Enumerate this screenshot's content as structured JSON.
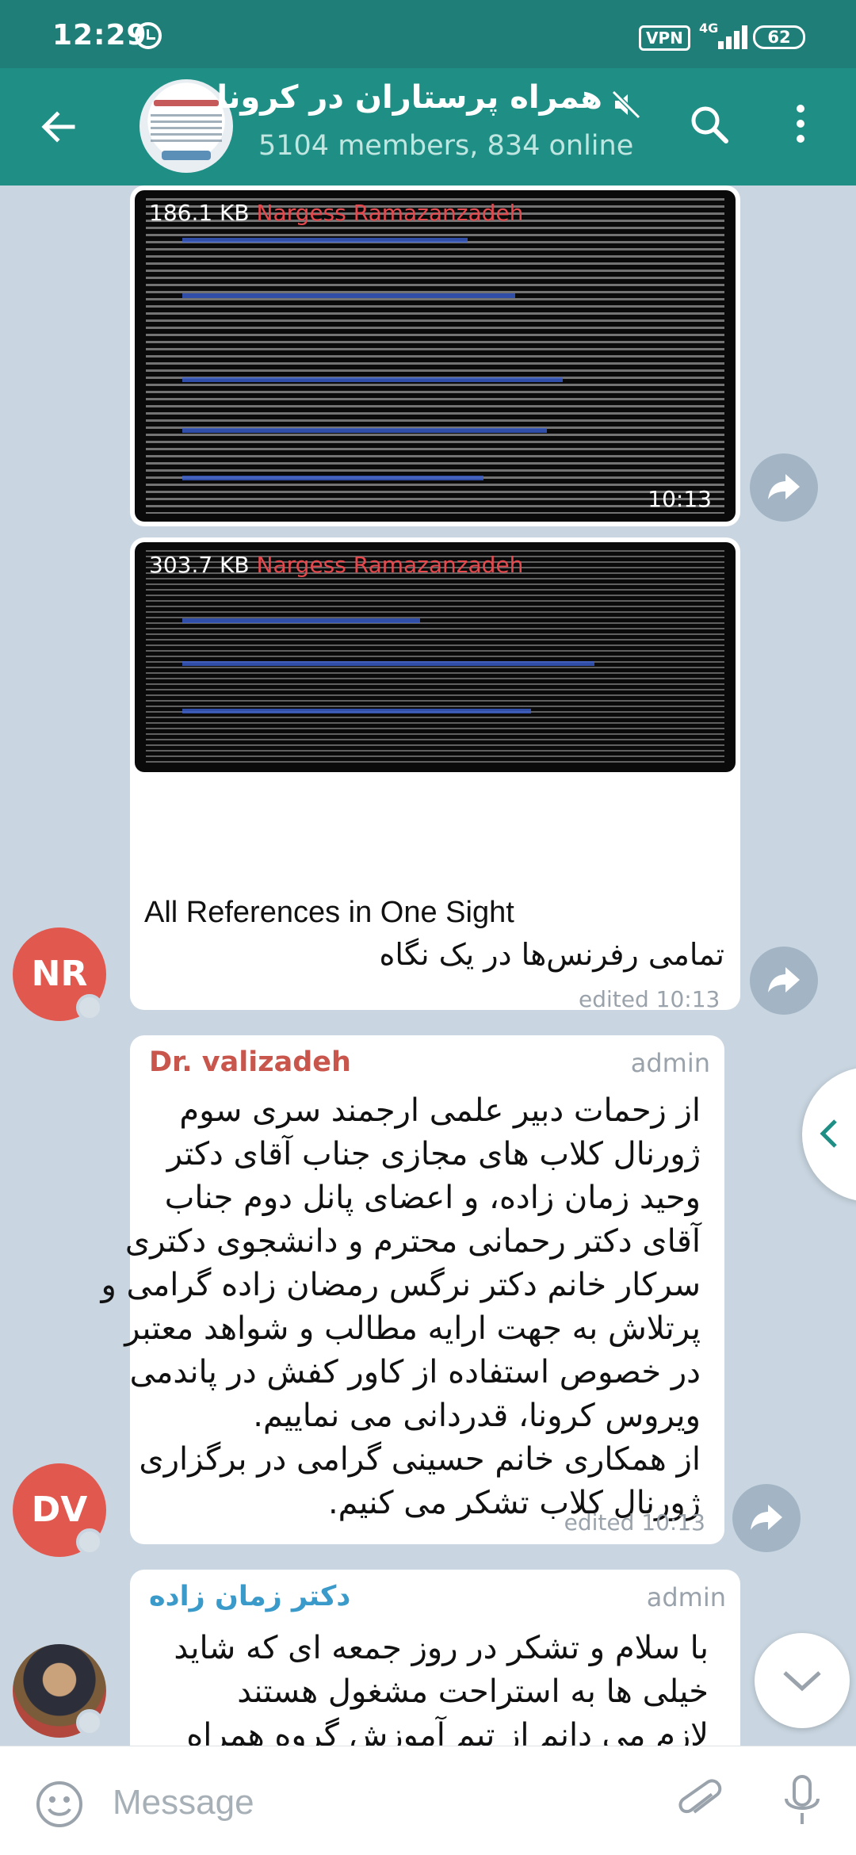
{
  "status_bar": {
    "time": "12:29",
    "vpn": "VPN",
    "network": "4G",
    "battery": "62"
  },
  "header": {
    "title": "همراه پرستاران در کرونا",
    "subtitle": "5104 members, 834 online"
  },
  "messages": [
    {
      "type": "file_image",
      "size": "186.1 KB",
      "sender": "Nargess Ramazanzadeh",
      "time": "10:13"
    },
    {
      "type": "file_image",
      "size": "303.7 KB",
      "sender": "Nargess Ramazanzadeh",
      "caption_en": "All References in One Sight",
      "caption_fa": "تمامی رفرنس‌ها در یک نگاه",
      "edited": "edited 10:13",
      "avatar_initials": "NR",
      "avatar_color": "#e1584f"
    },
    {
      "type": "text",
      "sender": "Dr. valizadeh",
      "sender_color": "#c9564d",
      "role": "admin",
      "lines": [
        "از زحمات دبیر علمی ارجمند سری سوم",
        "ژورنال کلاب های مجازی جناب آقای دکتر",
        "وحید زمان زاده، و اعضای پانل دوم جناب",
        "آقای دکتر رحمانی محترم و دانشجوی دکتری",
        "سرکار خانم دکتر نرگس رمضان زاده گرامی و",
        "پرتلاش به جهت ارایه مطالب و شواهد معتبر",
        "در خصوص استفاده از کاور کفش در پاندمی",
        "ویروس کرونا، قدردانی می نماییم.",
        "از همکاری خانم حسینی گرامی در برگزاری",
        "ژورنال کلاب تشکر می کنیم."
      ],
      "edited": "edited 10:13",
      "avatar_initials": "DV",
      "avatar_color": "#e1584f"
    },
    {
      "type": "text",
      "sender": "دکتر زمان زاده",
      "sender_color": "#3a9ac9",
      "role": "admin",
      "lines": [
        "با سلام و تشکر در روز جمعه ای که شاید",
        "خیلی ها به استراحت مشغول هستند",
        "لازم می دانم از تیم آموزش گروه همراه"
      ]
    }
  ],
  "input": {
    "placeholder": "Message"
  }
}
